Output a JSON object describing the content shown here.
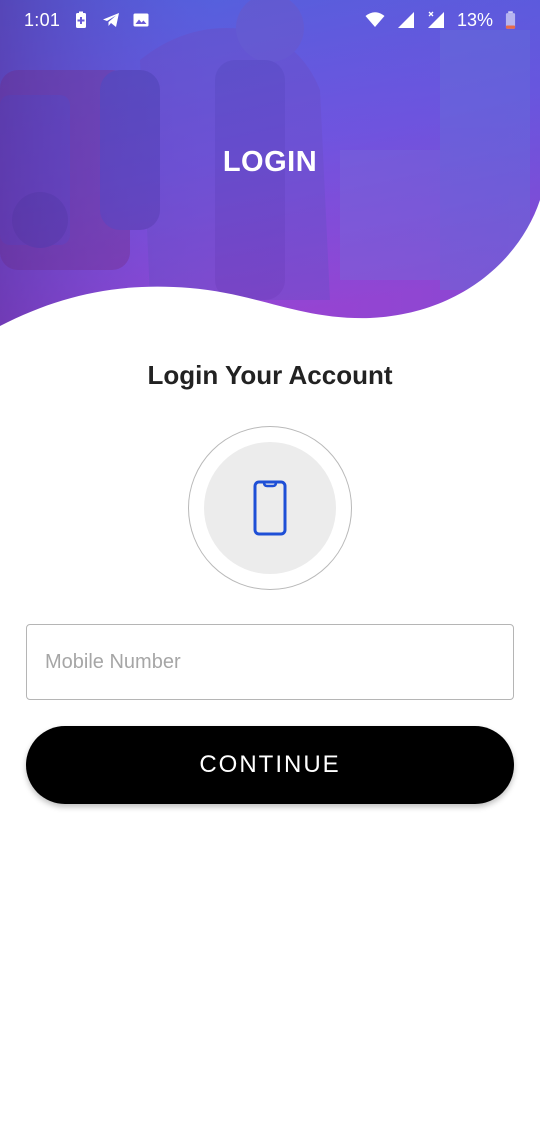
{
  "status_bar": {
    "time": "1:01",
    "battery_percent": "13%",
    "left_icons": [
      "battery-saver-icon",
      "telegram-icon",
      "image-icon"
    ],
    "right_icons": [
      "wifi-icon",
      "signal-icon",
      "signal-x-icon",
      "battery-icon"
    ]
  },
  "header": {
    "title": "LOGIN",
    "gradient_colors": [
      "#5a56d6",
      "#7a3fd8",
      "#9a3bd0"
    ]
  },
  "main": {
    "heading": "Login Your Account",
    "badge_icon": "smartphone-icon",
    "mobile_field": {
      "placeholder": "Mobile Number",
      "value": ""
    },
    "continue_label": "CONTINUE"
  },
  "colors": {
    "accent": "#1e4fd6",
    "button": "#000000"
  }
}
